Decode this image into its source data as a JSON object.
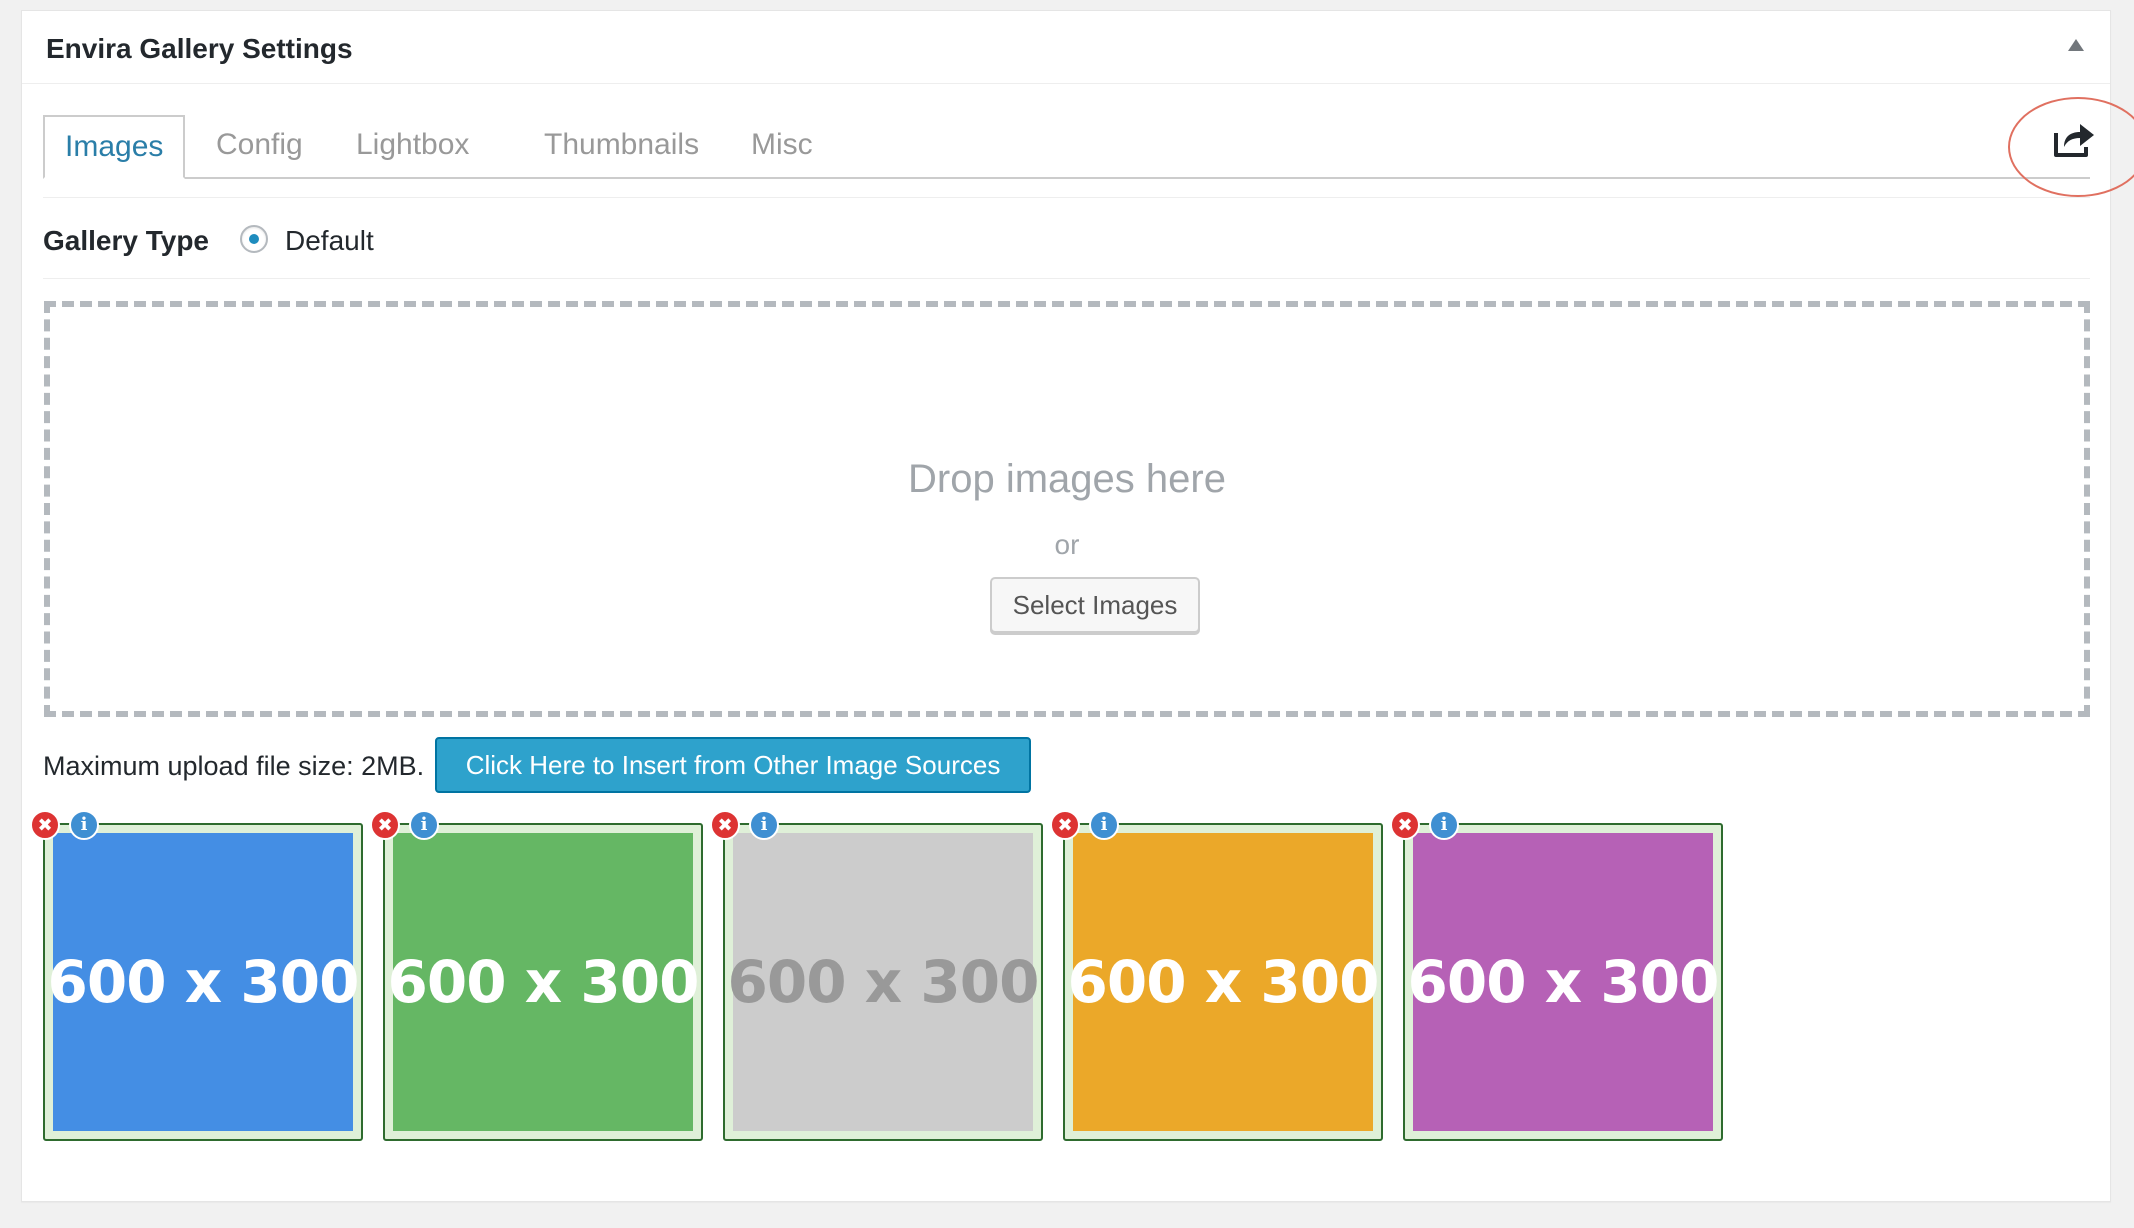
{
  "panel": {
    "title": "Envira Gallery Settings"
  },
  "tabs": [
    {
      "label": "Images",
      "active": true
    },
    {
      "label": "Config",
      "active": false
    },
    {
      "label": "Lightbox",
      "active": false
    },
    {
      "label": "Thumbnails",
      "active": false
    },
    {
      "label": "Misc",
      "active": false
    }
  ],
  "gallery_type": {
    "label": "Gallery Type",
    "selected_option": "Default"
  },
  "dropzone": {
    "heading": "Drop images here",
    "or_text": "or",
    "select_button": "Select Images"
  },
  "upload": {
    "max_size_text": "Maximum upload file size: 2MB.",
    "insert_button": "Click Here to Insert from Other Image Sources"
  },
  "images": [
    {
      "label": "600 x 300",
      "bg": "#448ee4",
      "fg": "#ffffff"
    },
    {
      "label": "600 x 300",
      "bg": "#65b764",
      "fg": "#ffffff"
    },
    {
      "label": "600 x 300",
      "bg": "#cccccc",
      "fg": "#999999"
    },
    {
      "label": "600 x 300",
      "bg": "#eba829",
      "fg": "#ffffff"
    },
    {
      "label": "600 x 300",
      "bg": "#b661b6",
      "fg": "#ffffff"
    }
  ],
  "icons": {
    "remove": "✖",
    "info": "i"
  },
  "colors": {
    "accent": "#2ea2cc",
    "active_tab": "#2a7ea8",
    "highlight": "#e07060"
  }
}
